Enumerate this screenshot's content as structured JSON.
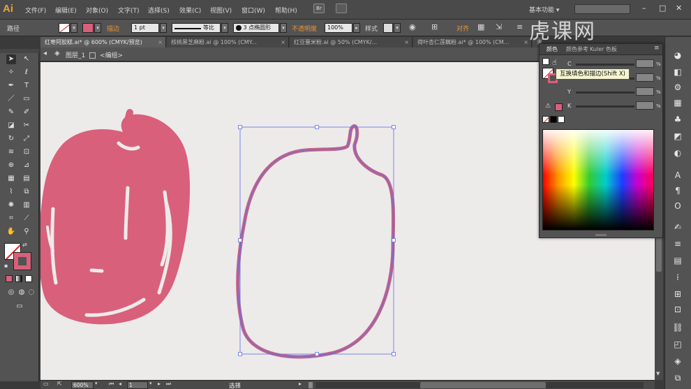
{
  "app": {
    "logo": "Ai"
  },
  "menu": {
    "items": [
      "文件(F)",
      "编辑(E)",
      "对象(O)",
      "文字(T)",
      "选择(S)",
      "效果(C)",
      "视图(V)",
      "窗口(W)",
      "帮助(H)"
    ],
    "bridge": "Br",
    "workspace": "基本功能 ▾"
  },
  "control_bar": {
    "object_label": "路径",
    "stroke_label": "描边",
    "stroke_value": "1 pt",
    "line_profile": "等比",
    "brush": "3 点椭圆形",
    "opacity_label": "不透明度",
    "opacity_value": "100%",
    "style_label": "样式",
    "align_label": "对齐"
  },
  "tabs": [
    {
      "label": "红枣阿胶糕.ai* @ 600% (CMYK/预览)",
      "active": true
    },
    {
      "label": "核桃黑芝麻粉.ai @ 100% (CMY...",
      "active": false
    },
    {
      "label": "红豆薏米粉.ai @ 50% (CMYK/...",
      "active": false
    },
    {
      "label": "荷叶杏仁莲藕粉.ai* @ 100% (CM...",
      "active": false
    },
    {
      "label": "未",
      "active": false
    }
  ],
  "breadcrumb": {
    "layer": "图层_1",
    "group": "<编组>"
  },
  "color_panel": {
    "tabs": [
      "颜色",
      "颜色参考",
      "Kuler 色板"
    ],
    "rows": [
      {
        "label": "C"
      },
      {
        "label": "M"
      },
      {
        "label": "Y"
      },
      {
        "label": "K"
      }
    ],
    "pct": "%",
    "tooltip": "互换填色和描边(Shift X)"
  },
  "status_bar": {
    "zoom": "600%",
    "page": "1",
    "status": "选择"
  },
  "watermark": "虎课网",
  "colors": {
    "accent": "#d9607a",
    "path_outline": "#c0638a",
    "selection": "#5a6ee8",
    "canvas": "#edeaea"
  }
}
